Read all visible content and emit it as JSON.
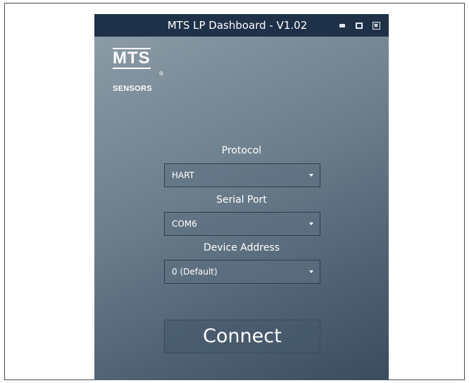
{
  "window": {
    "title": "MTS LP Dashboard - V1.02",
    "titlebar_color": "#1f3148",
    "controls": [
      "minimize-icon",
      "maximize-icon",
      "close-icon"
    ]
  },
  "logo": {
    "brand": "MTS",
    "registered": "®",
    "subtitle": "SENSORS"
  },
  "form": {
    "protocol": {
      "label": "Protocol",
      "value": "HART"
    },
    "serial_port": {
      "label": "Serial Port",
      "value": "COM6"
    },
    "device_address": {
      "label": "Device Address",
      "value": "0 (Default)"
    }
  },
  "actions": {
    "connect_label": "Connect"
  }
}
